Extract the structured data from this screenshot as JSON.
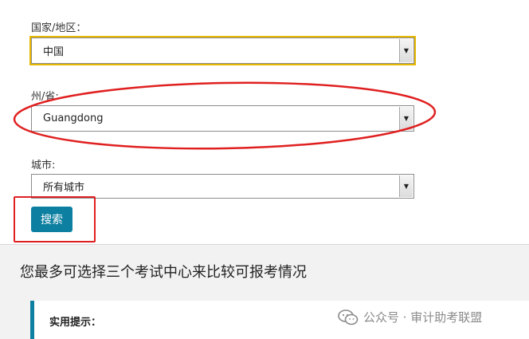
{
  "form": {
    "country": {
      "label": "国家/地区：",
      "value": "中国"
    },
    "state": {
      "label": "州/省:",
      "value": "Guangdong"
    },
    "city": {
      "label": "城市:",
      "value": "所有城市"
    },
    "search_button": "搜索"
  },
  "main": {
    "heading": "您最多可选择三个考试中心来比较可报考情况",
    "tip_label": "实用提示："
  },
  "watermark": {
    "text": "公众号 · 审计助考联盟",
    "icon": "wechat-icon"
  },
  "colors": {
    "accent": "#0d7fa0",
    "focus_outline": "#e6b800",
    "annotation": "#e02020"
  }
}
